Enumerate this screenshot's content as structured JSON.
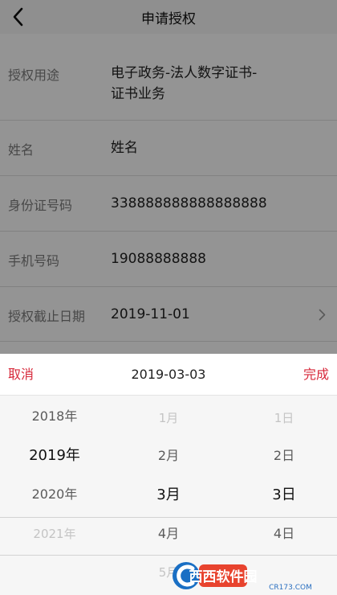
{
  "nav": {
    "title": "申请授权"
  },
  "form": {
    "rows": [
      {
        "label": "授权用途",
        "value_line1": "电子政务-法人数字证书-",
        "value_line2": "证书业务"
      },
      {
        "label": "姓名",
        "value": "姓名"
      },
      {
        "label": "身份证号码",
        "value": "338888888888888888"
      },
      {
        "label": "手机号码",
        "value": "19088888888"
      },
      {
        "label": "授权截止日期",
        "value": "2019-11-01"
      }
    ]
  },
  "picker": {
    "cancel_label": "取消",
    "done_label": "完成",
    "current_value": "2019-03-03",
    "years": [
      "2018年",
      "2019年",
      "2020年",
      "2021年"
    ],
    "months": [
      "1月",
      "2月",
      "3月",
      "4月",
      "5月"
    ],
    "days": [
      "1日",
      "2日",
      "3日",
      "4日"
    ]
  },
  "watermark": {
    "text": "西西软件园",
    "subtext": "CR173.COM"
  },
  "colors": {
    "accent": "#d7283a",
    "overlay": "rgba(0,0,0,0.42)"
  }
}
